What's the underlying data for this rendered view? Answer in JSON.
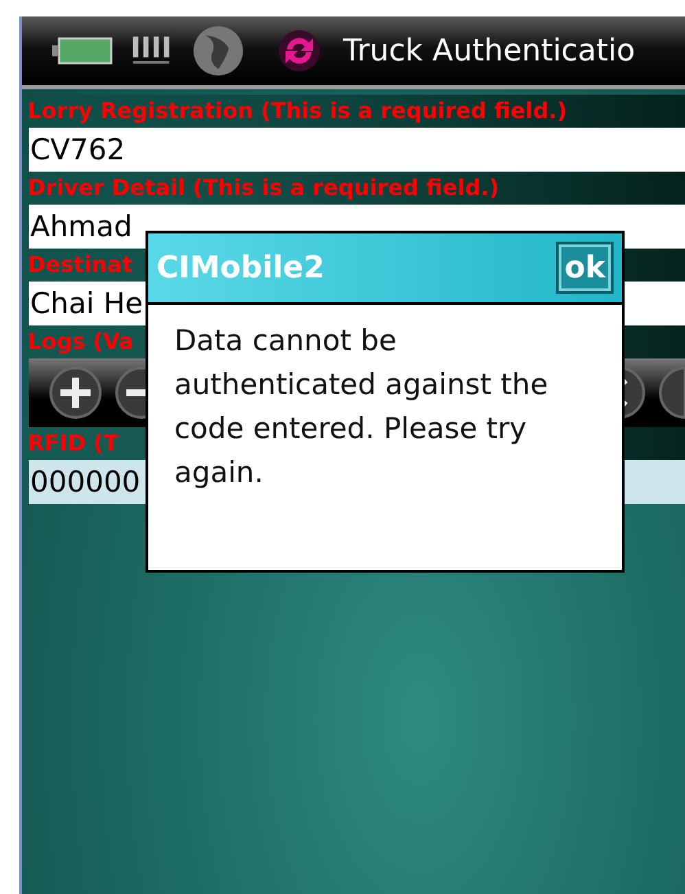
{
  "window": {
    "title": "Truck Authenticatio"
  },
  "form": [
    {
      "label": "Lorry Registration (This is a required field.)",
      "value": "CV762",
      "selected": false
    },
    {
      "label": "Driver Detail (This is a required field.)",
      "value": "Ahmad",
      "selected": false
    },
    {
      "label": "Destinat",
      "value": "Chai He",
      "selected": false
    }
  ],
  "logs": {
    "label": "Logs (Va"
  },
  "rfid": {
    "label": "RFID (T",
    "value": "000000",
    "selected": true
  },
  "dialog": {
    "title": "CIMobile2",
    "ok": "ok",
    "message": "Data cannot be authenticated against the code entered. Please try again."
  }
}
